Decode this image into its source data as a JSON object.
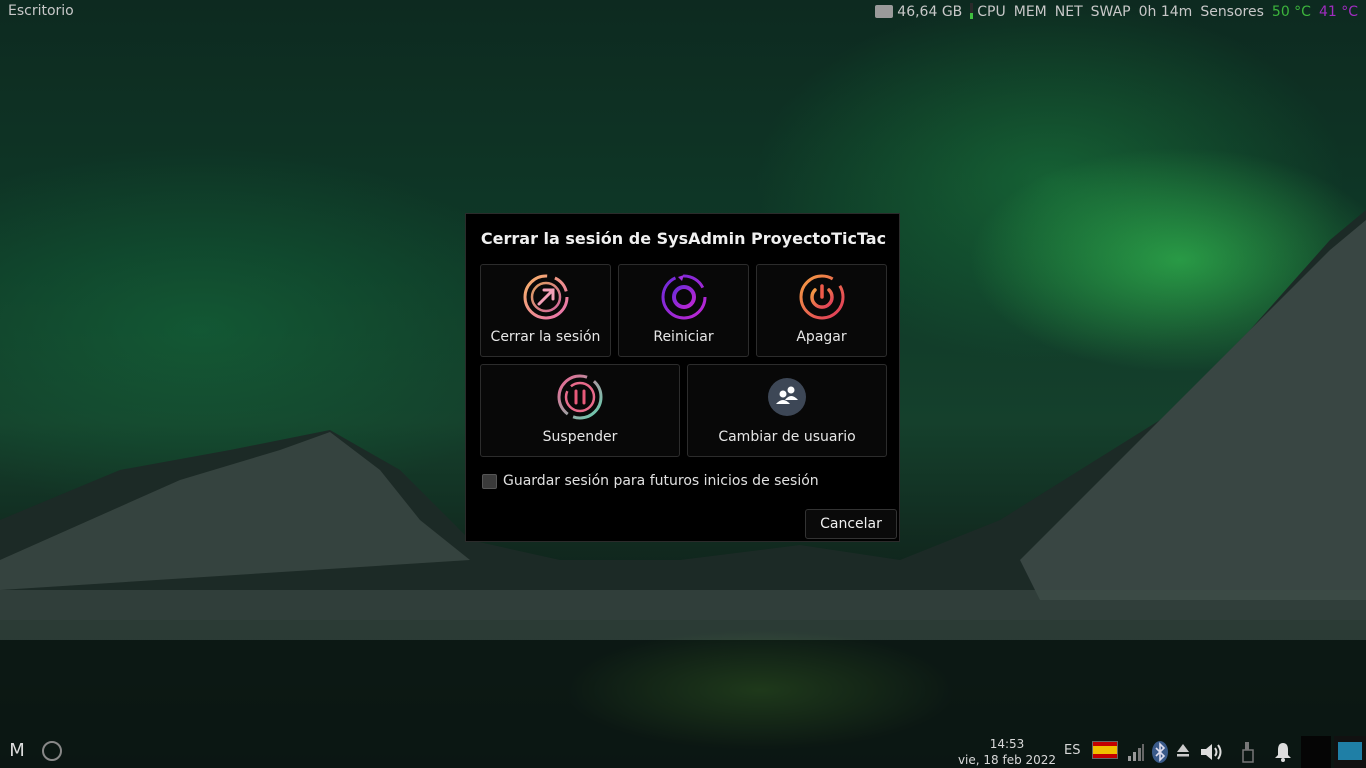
{
  "top_panel": {
    "desktop_label": "Escritorio",
    "disk_free": "46,64 GB",
    "cpu": "CPU",
    "mem": "MEM",
    "net": "NET",
    "swap": "SWAP",
    "uptime": "0h 14m",
    "sensors_label": "Sensores",
    "temp1": "50 °C",
    "temp2": "41 °C"
  },
  "dialog": {
    "title": "Cerrar la sesión de SysAdmin ProyectoTicTac",
    "options": [
      {
        "label": "Cerrar la sesión",
        "icon": "logout-icon"
      },
      {
        "label": "Reiniciar",
        "icon": "restart-icon"
      },
      {
        "label": "Apagar",
        "icon": "shutdown-icon"
      },
      {
        "label": "Suspender",
        "icon": "suspend-icon"
      },
      {
        "label": "Cambiar de usuario",
        "icon": "switch-user-icon"
      }
    ],
    "save_session_label": "Guardar sesión para futuros inicios de sesión",
    "save_session_checked": false,
    "cancel_label": "Cancelar"
  },
  "bottom_panel": {
    "menu_label": "M",
    "time": "14:53",
    "date": "vie, 18 feb 2022",
    "keyboard_layout": "ES",
    "tray_icons": [
      "spain-flag-icon",
      "network-signal-icon",
      "bluetooth-icon",
      "eject-icon",
      "volume-icon",
      "battery-icon",
      "notifications-bell-icon"
    ]
  },
  "colors": {
    "temp_green": "#3cb43c",
    "temp_purple": "#a02cbf",
    "dialog_bg": "#000000"
  }
}
